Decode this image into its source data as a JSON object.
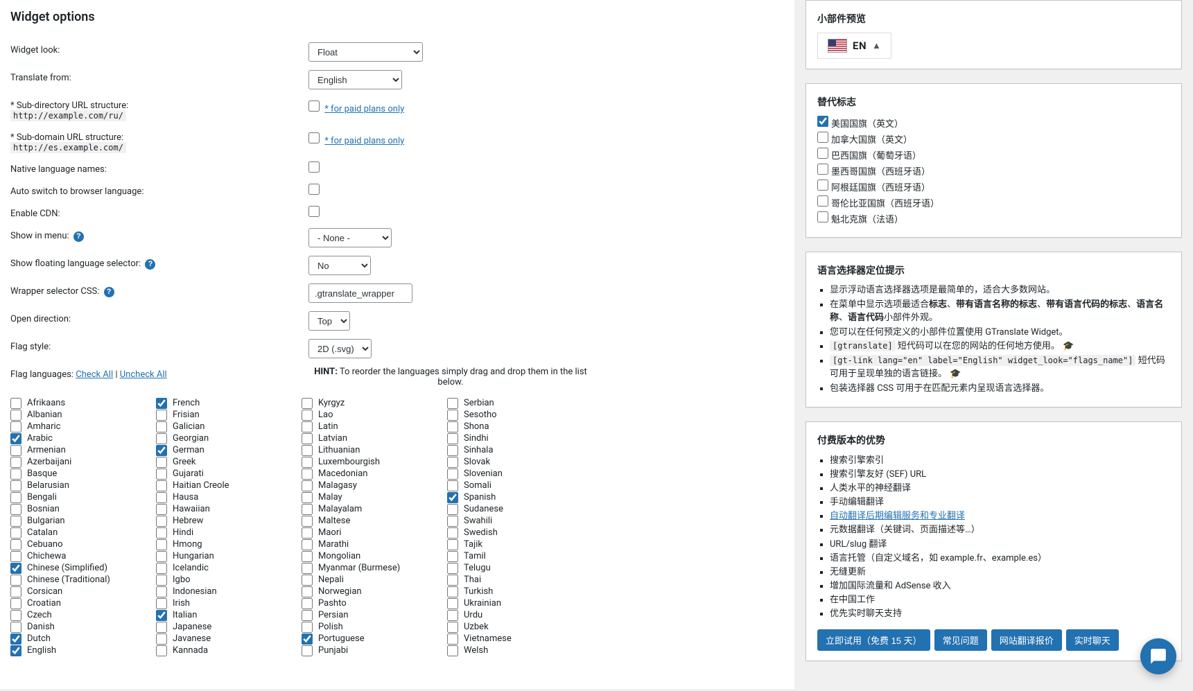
{
  "page_title": "Widget options",
  "fields": {
    "widget_look": {
      "label": "Widget look:",
      "value": "Float"
    },
    "translate_from": {
      "label": "Translate from:",
      "value": "English"
    },
    "sub_dir": {
      "label": "* Sub-directory URL structure:",
      "example": "http://example.com/ru/",
      "paid_link": "* for paid plans only"
    },
    "sub_domain": {
      "label": "* Sub-domain URL structure:",
      "example": "http://es.example.com/",
      "paid_link": "* for paid plans only"
    },
    "native_names": {
      "label": "Native language names:"
    },
    "auto_switch": {
      "label": "Auto switch to browser language:"
    },
    "enable_cdn": {
      "label": "Enable CDN:"
    },
    "show_in_menu": {
      "label": "Show in menu:",
      "value": "- None -"
    },
    "show_floating": {
      "label": "Show floating language selector:",
      "value": "No"
    },
    "wrapper_css": {
      "label": "Wrapper selector CSS:",
      "value": ".gtranslate_wrapper"
    },
    "open_direction": {
      "label": "Open direction:",
      "value": "Top"
    },
    "flag_style": {
      "label": "Flag style:",
      "value": "2D (.svg)"
    }
  },
  "flag_languages": {
    "label": "Flag languages:",
    "check_all": "Check All",
    "uncheck_all": "Uncheck All",
    "sep": " | "
  },
  "hint": {
    "bold": "HINT:",
    "text": " To reorder the languages simply drag and drop them in the list below."
  },
  "languages": {
    "col1": [
      {
        "n": "Afrikaans",
        "c": false
      },
      {
        "n": "Albanian",
        "c": false
      },
      {
        "n": "Amharic",
        "c": false
      },
      {
        "n": "Arabic",
        "c": true
      },
      {
        "n": "Armenian",
        "c": false
      },
      {
        "n": "Azerbaijani",
        "c": false
      },
      {
        "n": "Basque",
        "c": false
      },
      {
        "n": "Belarusian",
        "c": false
      },
      {
        "n": "Bengali",
        "c": false
      },
      {
        "n": "Bosnian",
        "c": false
      },
      {
        "n": "Bulgarian",
        "c": false
      },
      {
        "n": "Catalan",
        "c": false
      },
      {
        "n": "Cebuano",
        "c": false
      },
      {
        "n": "Chichewa",
        "c": false
      },
      {
        "n": "Chinese (Simplified)",
        "c": true
      },
      {
        "n": "Chinese (Traditional)",
        "c": false
      },
      {
        "n": "Corsican",
        "c": false
      },
      {
        "n": "Croatian",
        "c": false
      },
      {
        "n": "Czech",
        "c": false
      },
      {
        "n": "Danish",
        "c": false
      },
      {
        "n": "Dutch",
        "c": true
      },
      {
        "n": "English",
        "c": true
      }
    ],
    "col2": [
      {
        "n": "French",
        "c": true
      },
      {
        "n": "Frisian",
        "c": false
      },
      {
        "n": "Galician",
        "c": false
      },
      {
        "n": "Georgian",
        "c": false
      },
      {
        "n": "German",
        "c": true
      },
      {
        "n": "Greek",
        "c": false
      },
      {
        "n": "Gujarati",
        "c": false
      },
      {
        "n": "Haitian Creole",
        "c": false
      },
      {
        "n": "Hausa",
        "c": false
      },
      {
        "n": "Hawaiian",
        "c": false
      },
      {
        "n": "Hebrew",
        "c": false
      },
      {
        "n": "Hindi",
        "c": false
      },
      {
        "n": "Hmong",
        "c": false
      },
      {
        "n": "Hungarian",
        "c": false
      },
      {
        "n": "Icelandic",
        "c": false
      },
      {
        "n": "Igbo",
        "c": false
      },
      {
        "n": "Indonesian",
        "c": false
      },
      {
        "n": "Irish",
        "c": false
      },
      {
        "n": "Italian",
        "c": true
      },
      {
        "n": "Japanese",
        "c": false
      },
      {
        "n": "Javanese",
        "c": false
      },
      {
        "n": "Kannada",
        "c": false
      }
    ],
    "col3": [
      {
        "n": "Kyrgyz",
        "c": false
      },
      {
        "n": "Lao",
        "c": false
      },
      {
        "n": "Latin",
        "c": false
      },
      {
        "n": "Latvian",
        "c": false
      },
      {
        "n": "Lithuanian",
        "c": false
      },
      {
        "n": "Luxembourgish",
        "c": false
      },
      {
        "n": "Macedonian",
        "c": false
      },
      {
        "n": "Malagasy",
        "c": false
      },
      {
        "n": "Malay",
        "c": false
      },
      {
        "n": "Malayalam",
        "c": false
      },
      {
        "n": "Maltese",
        "c": false
      },
      {
        "n": "Maori",
        "c": false
      },
      {
        "n": "Marathi",
        "c": false
      },
      {
        "n": "Mongolian",
        "c": false
      },
      {
        "n": "Myanmar (Burmese)",
        "c": false
      },
      {
        "n": "Nepali",
        "c": false
      },
      {
        "n": "Norwegian",
        "c": false
      },
      {
        "n": "Pashto",
        "c": false
      },
      {
        "n": "Persian",
        "c": false
      },
      {
        "n": "Polish",
        "c": false
      },
      {
        "n": "Portuguese",
        "c": true
      },
      {
        "n": "Punjabi",
        "c": false
      }
    ],
    "col4": [
      {
        "n": "Serbian",
        "c": false
      },
      {
        "n": "Sesotho",
        "c": false
      },
      {
        "n": "Shona",
        "c": false
      },
      {
        "n": "Sindhi",
        "c": false
      },
      {
        "n": "Sinhala",
        "c": false
      },
      {
        "n": "Slovak",
        "c": false
      },
      {
        "n": "Slovenian",
        "c": false
      },
      {
        "n": "Somali",
        "c": false
      },
      {
        "n": "Spanish",
        "c": true
      },
      {
        "n": "Sudanese",
        "c": false
      },
      {
        "n": "Swahili",
        "c": false
      },
      {
        "n": "Swedish",
        "c": false
      },
      {
        "n": "Tajik",
        "c": false
      },
      {
        "n": "Tamil",
        "c": false
      },
      {
        "n": "Telugu",
        "c": false
      },
      {
        "n": "Thai",
        "c": false
      },
      {
        "n": "Turkish",
        "c": false
      },
      {
        "n": "Ukrainian",
        "c": false
      },
      {
        "n": "Urdu",
        "c": false
      },
      {
        "n": "Uzbek",
        "c": false
      },
      {
        "n": "Vietnamese",
        "c": false
      },
      {
        "n": "Welsh",
        "c": false
      }
    ]
  },
  "preview": {
    "title": "小部件预览",
    "lang_code": "EN"
  },
  "alt_flags": {
    "title": "替代标志",
    "items": [
      {
        "label": "美国国旗（英文）",
        "checked": true
      },
      {
        "label": "加拿大国旗（英文）",
        "checked": false
      },
      {
        "label": "巴西国旗（葡萄牙语）",
        "checked": false
      },
      {
        "label": "墨西哥国旗（西班牙语）",
        "checked": false
      },
      {
        "label": "阿根廷国旗（西班牙语）",
        "checked": false
      },
      {
        "label": "哥伦比亚国旗（西班牙语）",
        "checked": false
      },
      {
        "label": "魁北克旗（法语）",
        "checked": false
      }
    ]
  },
  "tips": {
    "title": "语言选择器定位提示",
    "items": [
      "显示浮动语言选择器选项是最简单的，适合大多数网站。",
      "在菜单中显示选项最适合标志、带有语言名称的标志、带有语言代码的标志、语言名称、语言代码小部件外观。",
      "您可以在任何预定义的小部件位置使用 GTranslate Widget。",
      "[gtranslate] 短代码可以在您的网站的任何地方使用。",
      "[gt-link lang=\"en\" label=\"English\" widget_look=\"flags_name\"] 短代码可用于呈现单独的语言链接。",
      "包装选择器 CSS 可用于在匹配元素内呈现语言选择器。"
    ],
    "bold_segments": {
      "1": [
        "标志",
        "带有语言名称的标志",
        "带有语言代码的标志",
        "语言名称",
        "语言代码"
      ]
    }
  },
  "paid": {
    "title": "付费版本的优势",
    "items": [
      "搜索引擎索引",
      "搜索引擎友好 (SEF) URL",
      "人类水平的神经翻译",
      "手动编辑翻译",
      "自动翻译后期编辑服务和专业翻译",
      "元数据翻译（关键词、页面描述等…）",
      "URL/slug 翻译",
      "语言托管（自定义域名，如 example.fr、example.es）",
      "无缝更新",
      "增加国际流量和 AdSense 收入",
      "在中国工作",
      "优先实时聊天支持"
    ],
    "link_index": 4,
    "buttons": [
      "立即试用（免费 15 天）",
      "常见问题",
      "网站翻译报价",
      "实时聊天"
    ]
  }
}
